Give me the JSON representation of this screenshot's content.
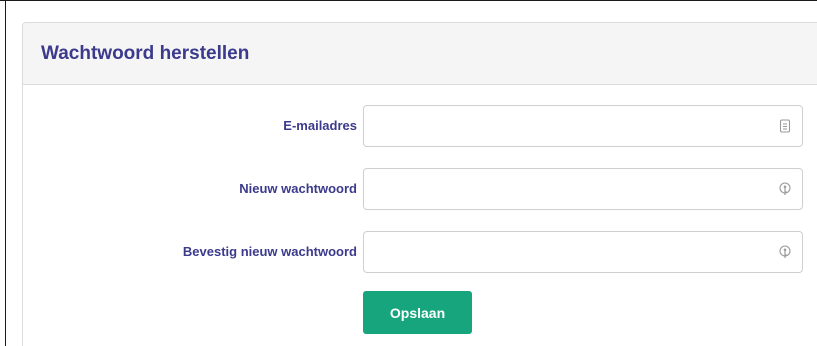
{
  "panel": {
    "title": "Wachtwoord herstellen"
  },
  "form": {
    "fields": [
      {
        "label": "E-mailadres",
        "value": "",
        "placeholder": "",
        "icon": "contact-card-icon"
      },
      {
        "label": "Nieuw wachtwoord",
        "value": "",
        "placeholder": "",
        "icon": "key-icon"
      },
      {
        "label": "Bevestig nieuw wachtwoord",
        "value": "",
        "placeholder": "",
        "icon": "key-icon"
      }
    ],
    "submit_label": "Opslaan"
  },
  "colors": {
    "label_text": "#3b3a8c",
    "button_bg": "#17a57e",
    "heading_bg": "#f5f5f5"
  }
}
